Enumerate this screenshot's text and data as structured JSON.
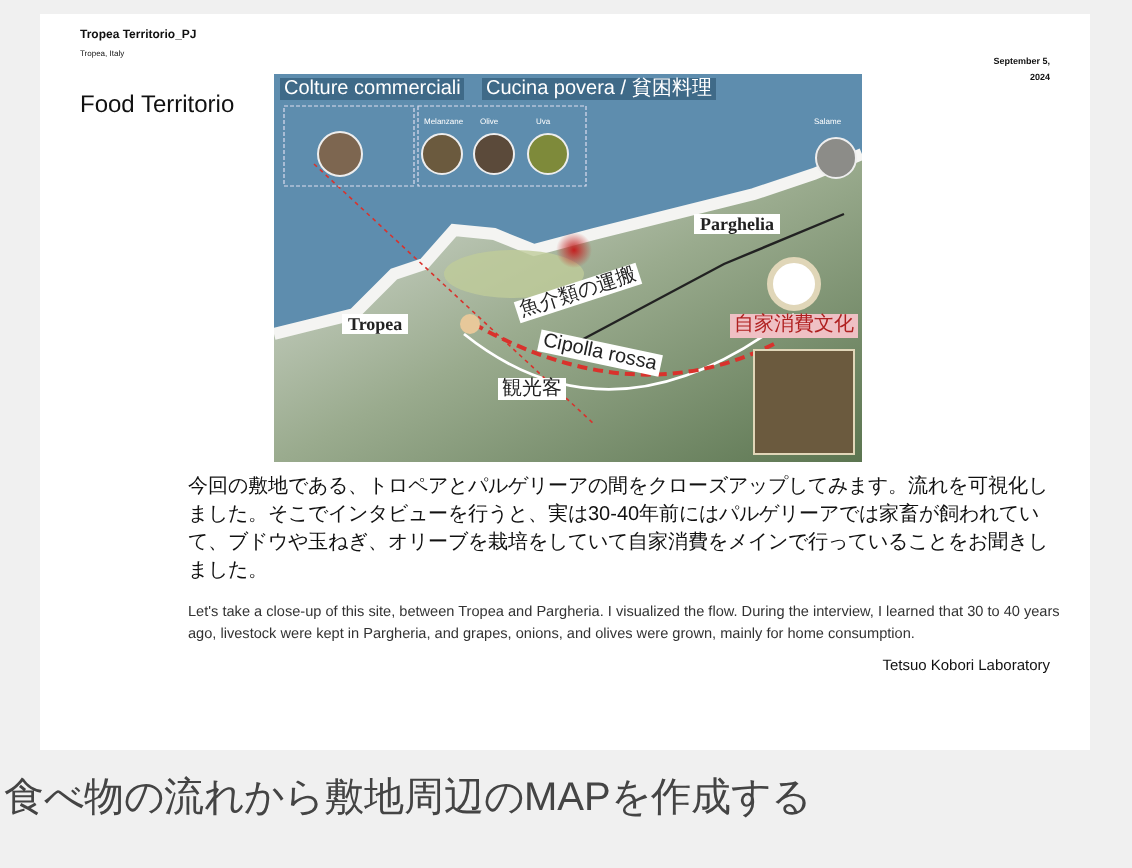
{
  "header": {
    "project": "Tropea Territorio_PJ",
    "location": "Tropea, Italy",
    "date_line_1": "September 5,",
    "date_line_2": "2024"
  },
  "title": "Food Territorio",
  "map": {
    "group_labels": [
      {
        "text": "Colture commerciali"
      },
      {
        "text": "Cucina povera / 貧困料理"
      }
    ],
    "photo_labels": [
      "Melanzane",
      "Olive",
      "Uva",
      "Salame"
    ],
    "places": [
      {
        "text": "Tropea",
        "kind": "place"
      },
      {
        "text": "Parghelia",
        "kind": "place"
      }
    ],
    "routes": [
      {
        "text": "魚介類の運搬"
      },
      {
        "text": "Cipolla rossa"
      },
      {
        "text": "観光客"
      }
    ],
    "badge": "自家消費文化"
  },
  "paragraph_ja": "今回の敷地である、トロペアとパルゲリーアの間をクローズアップしてみます。流れを可視化しました。そこでインタビューを行うと、実は30-40年前にはパルゲリーアでは家畜が飼われていて、ブドウや玉ねぎ、オリーブを栽培をしていて自家消費をメインで行っていることをお聞きしました。",
  "paragraph_en": "Let's take a close-up of this site, between Tropea and Pargheria. I visualized the flow. During the interview, I learned that 30 to 40 years ago, livestock were kept in Pargheria, and grapes, onions, and olives were grown, mainly for home consumption.",
  "credit": "Tetsuo Kobori Laboratory",
  "caption": "食べ物の流れから敷地周辺のMAPを作成する"
}
